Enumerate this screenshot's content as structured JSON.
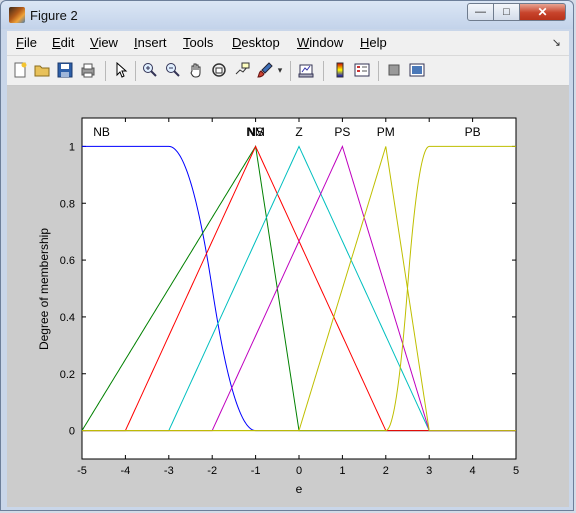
{
  "window": {
    "title": "Figure 2",
    "minimize_glyph": "—",
    "maximize_glyph": "□",
    "close_glyph": "✕"
  },
  "menu": [
    "File",
    "Edit",
    "View",
    "Insert",
    "Tools",
    "Desktop",
    "Window",
    "Help"
  ],
  "menu_arrow": "↘",
  "toolbar": {
    "icons": [
      "new-figure-icon",
      "open-icon",
      "save-icon",
      "print-icon",
      "pointer-icon",
      "zoom-in-icon",
      "zoom-out-icon",
      "pan-icon",
      "rotate-icon",
      "data-cursor-icon",
      "brush-icon",
      "brush-dropdown-icon",
      "link-plot-icon",
      "colorbar-icon",
      "legend-icon",
      "hide-plot-tools-icon",
      "show-plot-tools-icon"
    ]
  },
  "colors": {
    "NB": "#0000ff",
    "NM": "#008000",
    "NS": "#ff0000",
    "Z": "#00bfbf",
    "PS": "#bf00bf",
    "PM": "#bfbf00",
    "PB": "#bfbf00",
    "background": "#cccccc",
    "axes": "#ffffff"
  },
  "chart_data": {
    "type": "line",
    "title": "",
    "xlabel": "e",
    "ylabel": "Degree of membership",
    "xlim": [
      -5,
      5
    ],
    "ylim": [
      -0.1,
      1.1
    ],
    "xticks": [
      -5,
      -4,
      -3,
      -2,
      -1,
      0,
      1,
      2,
      3,
      4,
      5
    ],
    "yticks": [
      0,
      0.2,
      0.4,
      0.6,
      0.8,
      1
    ],
    "ytick_labels": [
      "0",
      "0.2",
      "0.4",
      "0.6",
      "0.8",
      "1"
    ],
    "grid": false,
    "series": [
      {
        "name": "NB",
        "shape": "zmf",
        "params": [
          -3,
          -1
        ],
        "label_x": -4.55
      },
      {
        "name": "NM",
        "shape": "trimf",
        "params": [
          -5,
          -1,
          0
        ],
        "label_x": -1
      },
      {
        "name": "NS",
        "shape": "trimf",
        "params": [
          -4,
          -1,
          2
        ],
        "label_x": -1
      },
      {
        "name": "Z",
        "shape": "trimf",
        "params": [
          -3,
          0,
          3
        ],
        "label_x": 0
      },
      {
        "name": "PS",
        "shape": "trimf",
        "params": [
          -2,
          1,
          3
        ],
        "label_x": 1
      },
      {
        "name": "PM",
        "shape": "trimf",
        "params": [
          0,
          2,
          3
        ],
        "label_x": 2
      },
      {
        "name": "PB",
        "shape": "smf",
        "params": [
          2,
          3
        ],
        "label_x": 4
      }
    ]
  }
}
